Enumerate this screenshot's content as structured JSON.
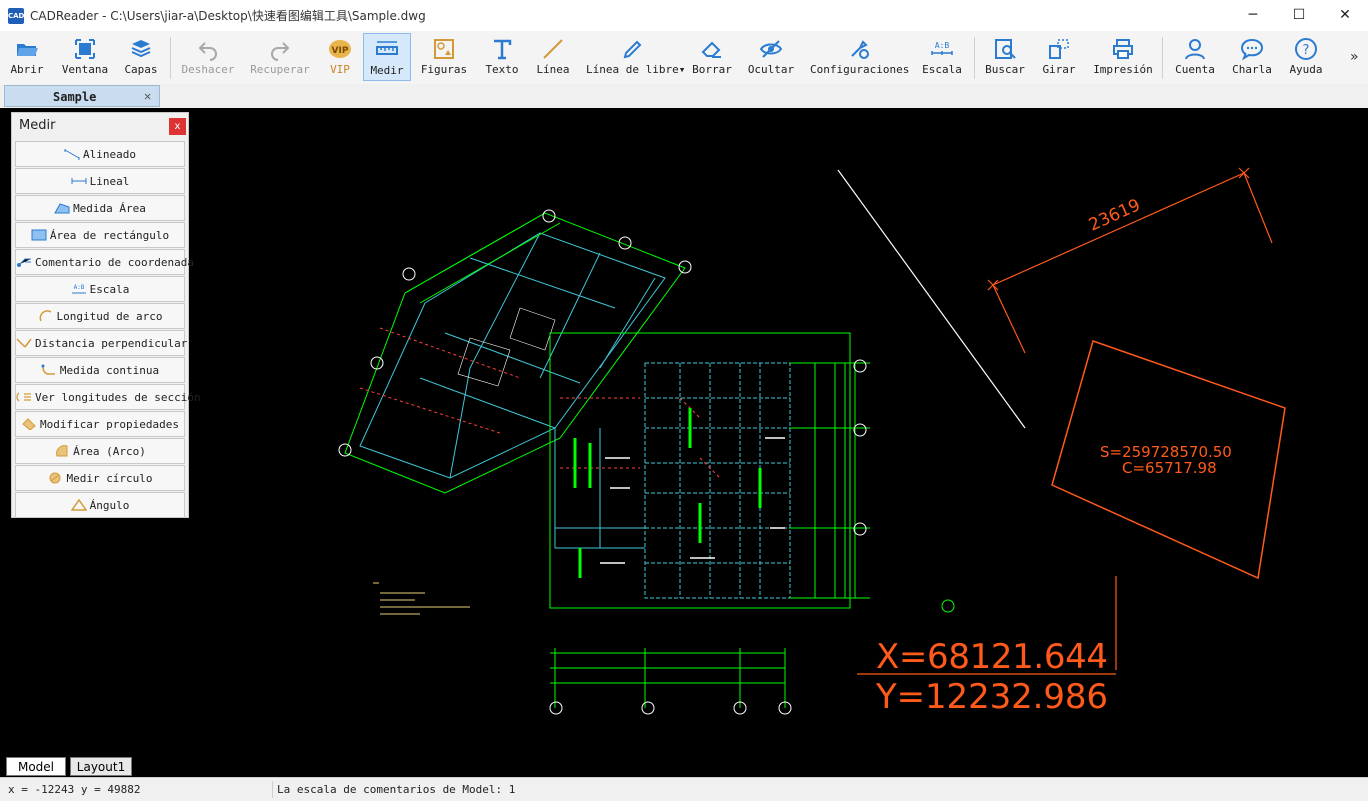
{
  "window": {
    "title": "CADReader - C:\\Users\\jiar-a\\Desktop\\快速看图编辑工具\\Sample.dwg",
    "app_icon_text": "CAD",
    "minimize": "─",
    "maximize": "☐",
    "close": "✕"
  },
  "toolbar": {
    "abrir": "Abrir",
    "ventana": "Ventana",
    "capas": "Capas",
    "deshacer": "Deshacer",
    "recuperar": "Recuperar",
    "vip": "VIP",
    "medir": "Medir",
    "figuras": "Figuras",
    "texto": "Texto",
    "linea": "Línea",
    "linea_libre": "Línea de libre▾",
    "borrar": "Borrar",
    "ocultar": "Ocultar",
    "configuraciones": "Configuraciones",
    "escala": "Escala",
    "buscar": "Buscar",
    "girar": "Girar",
    "impresion": "Impresión",
    "cuenta": "Cuenta",
    "charla": "Charla",
    "ayuda": "Ayuda",
    "overflow": "»",
    "accent_color": "#2b7bd1",
    "disabled_color": "#9a9a9a"
  },
  "document_tab": {
    "name": "Sample",
    "close": "✕"
  },
  "measure_panel": {
    "title": "Medir",
    "close": "x",
    "items": [
      {
        "label": "Alineado",
        "icon": "aligned-icon"
      },
      {
        "label": "Lineal",
        "icon": "linear-icon"
      },
      {
        "label": "Medida Área",
        "icon": "area-icon"
      },
      {
        "label": "Área de rectángulo",
        "icon": "rect-area-icon"
      },
      {
        "label": "Comentario de coordenada",
        "icon": "coordinate-icon"
      },
      {
        "label": "Escala",
        "icon": "scale-icon"
      },
      {
        "label": "Longitud de arco",
        "icon": "arc-length-icon"
      },
      {
        "label": "Distancia perpendicular",
        "icon": "perpendicular-icon"
      },
      {
        "label": "Medida continua",
        "icon": "continuous-icon"
      },
      {
        "label": "Ver longitudes de sección",
        "icon": "section-length-icon"
      },
      {
        "label": "Modificar propiedades",
        "icon": "properties-icon"
      },
      {
        "label": "Área (Arco)",
        "icon": "arc-area-icon"
      },
      {
        "label": "Medir círculo",
        "icon": "circle-icon"
      },
      {
        "label": "Ángulo",
        "icon": "angle-icon"
      }
    ]
  },
  "drawing": {
    "dimension_value": "23619",
    "area_s": "S=259728570.50",
    "area_c": "C=65717.98",
    "coord_x": "X=68121.644",
    "coord_y": "Y=12232.986",
    "orange_color": "#ff5a1a",
    "green_color": "#00ff00",
    "cyan_color": "#3fc8d8"
  },
  "sheets": {
    "model": "Model",
    "layout": "Layout1"
  },
  "status": {
    "coords": "x = -12243 y = 49882",
    "message": "La escala de comentarios de Model: 1"
  }
}
